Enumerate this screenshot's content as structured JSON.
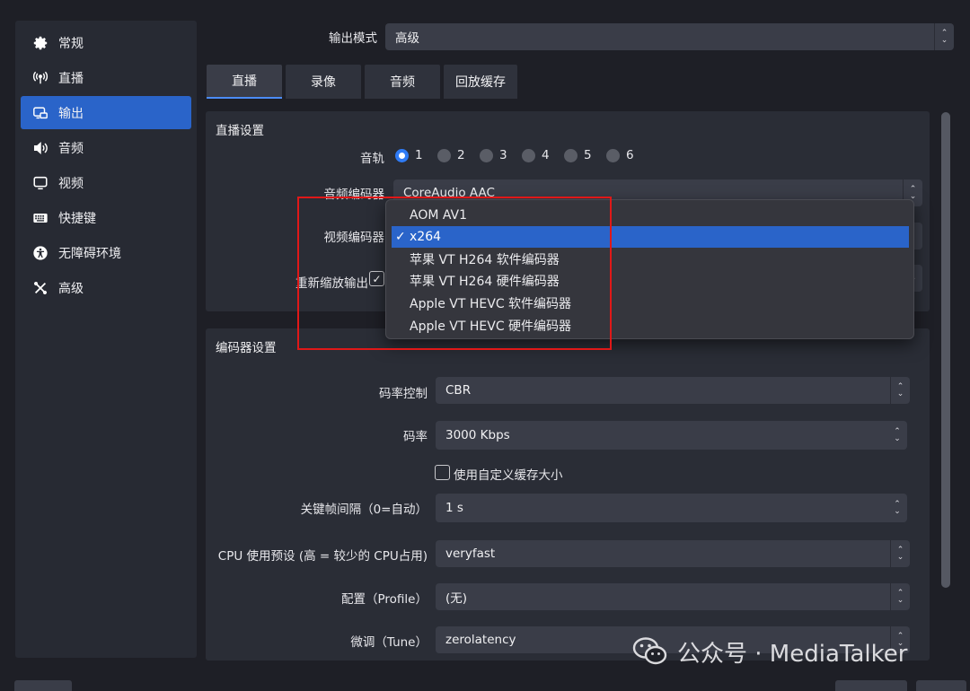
{
  "sidebar": {
    "items": [
      {
        "label": "常规",
        "icon": "gear-icon"
      },
      {
        "label": "直播",
        "icon": "broadcast-antenna-icon"
      },
      {
        "label": "输出",
        "icon": "output-icon"
      },
      {
        "label": "音频",
        "icon": "speaker-icon"
      },
      {
        "label": "视频",
        "icon": "monitor-icon"
      },
      {
        "label": "快捷键",
        "icon": "keyboard-icon"
      },
      {
        "label": "无障碍环境",
        "icon": "accessibility-icon"
      },
      {
        "label": "高级",
        "icon": "tools-icon"
      }
    ],
    "active_index": 2
  },
  "output_mode": {
    "label": "输出模式",
    "value": "高级"
  },
  "tabs": [
    {
      "label": "直播"
    },
    {
      "label": "录像"
    },
    {
      "label": "音频"
    },
    {
      "label": "回放缓存"
    }
  ],
  "stream_settings": {
    "title": "直播设置",
    "audio_track_label": "音轨",
    "tracks": [
      "1",
      "2",
      "3",
      "4",
      "5",
      "6"
    ],
    "selected_track": "1",
    "audio_encoder_label": "音频编码器",
    "audio_encoder_value": "CoreAudio AAC",
    "video_encoder_label": "视频编码器",
    "rescale_label": "重新缩放输出"
  },
  "encoder_menu": {
    "items": [
      "AOM AV1",
      "x264",
      "苹果 VT H264 软件编码器",
      "苹果 VT H264 硬件编码器",
      "Apple VT HEVC 软件编码器",
      "Apple VT HEVC 硬件编码器"
    ],
    "selected": "x264",
    "check": "✓"
  },
  "encoder_settings": {
    "title": "编码器设置",
    "rate_control_label": "码率控制",
    "rate_control_value": "CBR",
    "bitrate_label": "码率",
    "bitrate_value": "3000 Kbps",
    "custom_buffer_label": "使用自定义缓存大小",
    "keyframe_label": "关键帧间隔（0=自动）",
    "keyframe_value": "1 s",
    "cpu_preset_label": "CPU 使用预设 (高 = 较少的 CPU占用)",
    "cpu_preset_value": "veryfast",
    "profile_label": "配置（Profile）",
    "profile_value": "(无)",
    "tune_label": "微调（Tune）",
    "tune_value": "zerolatency"
  },
  "watermark": {
    "text": "公众号 · MediaTalker"
  },
  "colors": {
    "accent": "#2a64c9",
    "highlight_box": "#e01818"
  }
}
